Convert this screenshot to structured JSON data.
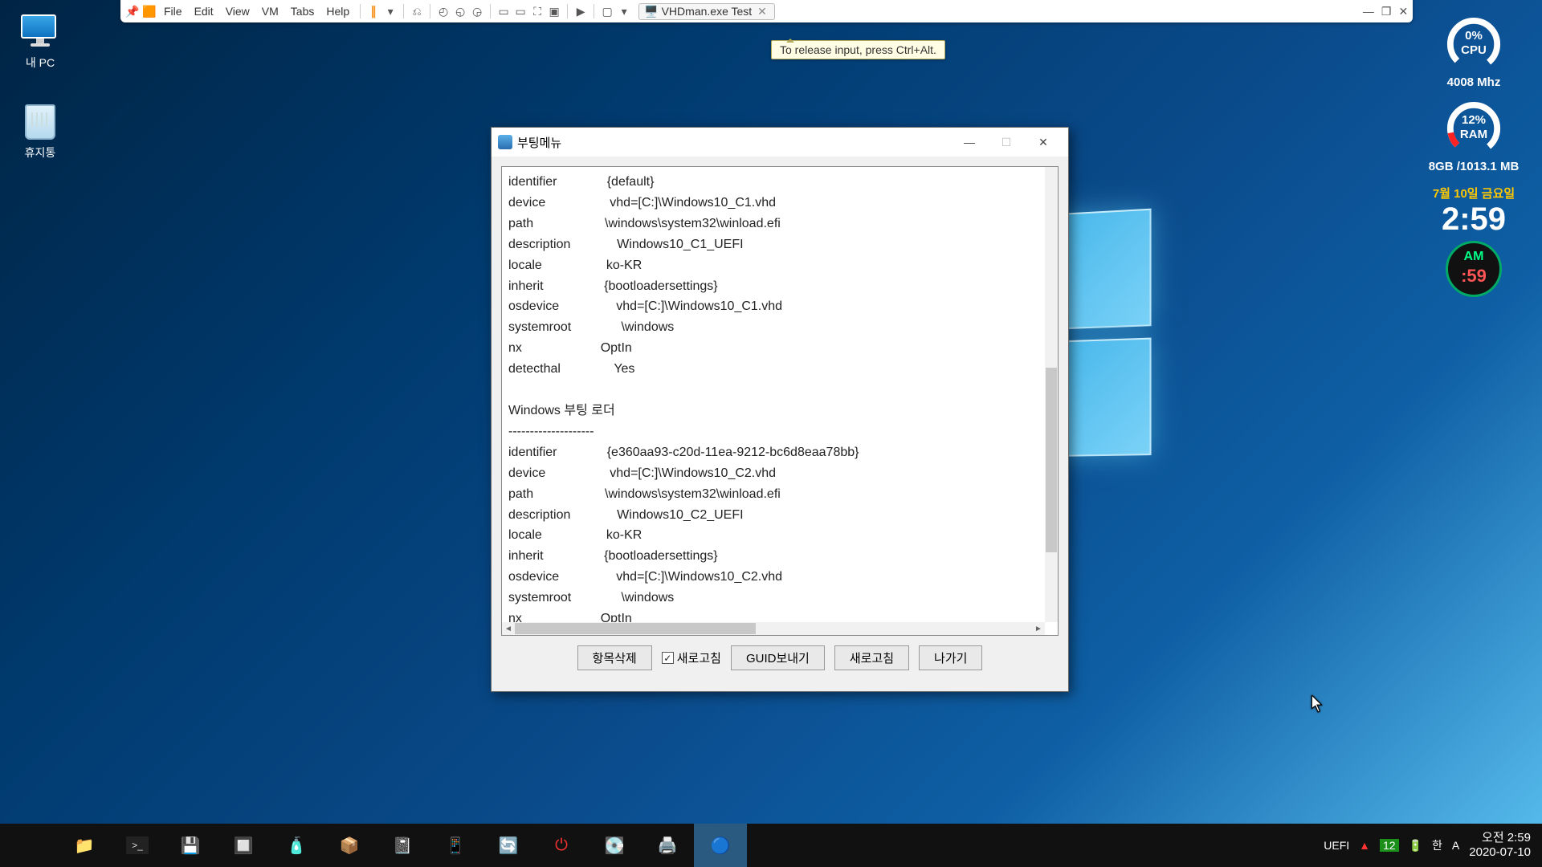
{
  "vmtoolbar": {
    "menus": [
      "File",
      "Edit",
      "View",
      "VM",
      "Tabs",
      "Help"
    ],
    "tab_label": "VHDman.exe Test",
    "tooltip": "To release input, press Ctrl+Alt."
  },
  "desktop_icons": {
    "pc": "내 PC",
    "recycle": "휴지통"
  },
  "widgets": {
    "cpu_pct": "0%",
    "cpu_label": "CPU",
    "cpu_freq": "4008 Mhz",
    "ram_pct": "12%",
    "ram_label": "RAM",
    "ram_text": "8GB /1013.1 MB",
    "date": "7월 10일 금요일",
    "time": "2:59",
    "ampm": "AM",
    "sec": ":59"
  },
  "dialog": {
    "title": "부팅메뉴",
    "textlines": [
      "identifier              {default}",
      "device                  vhd=[C:]\\Windows10_C1.vhd",
      "path                    \\windows\\system32\\winload.efi",
      "description             Windows10_C1_UEFI",
      "locale                  ko-KR",
      "inherit                 {bootloadersettings}",
      "osdevice                vhd=[C:]\\Windows10_C1.vhd",
      "systemroot              \\windows",
      "nx                      OptIn",
      "detecthal               Yes",
      "",
      "Windows 부팅 로더",
      "--------------------",
      "identifier              {e360aa93-c20d-11ea-9212-bc6d8eaa78bb}",
      "device                  vhd=[C:]\\Windows10_C2.vhd",
      "path                    \\windows\\system32\\winload.efi",
      "description             Windows10_C2_UEFI",
      "locale                  ko-KR",
      "inherit                 {bootloadersettings}",
      "osdevice                vhd=[C:]\\Windows10_C2.vhd",
      "systemroot              \\windows",
      "nx                      OptIn"
    ],
    "buttons": {
      "delete": "항목삭제",
      "refresh_chk": "새로고침",
      "guid": "GUID보내기",
      "refresh": "새로고침",
      "exit": "나가기"
    }
  },
  "taskbar": {
    "uefi": "UEFI",
    "num": "12",
    "ime_ko": "한",
    "ime_a": "A",
    "clock_time": "오전 2:59",
    "clock_date": "2020-07-10"
  }
}
